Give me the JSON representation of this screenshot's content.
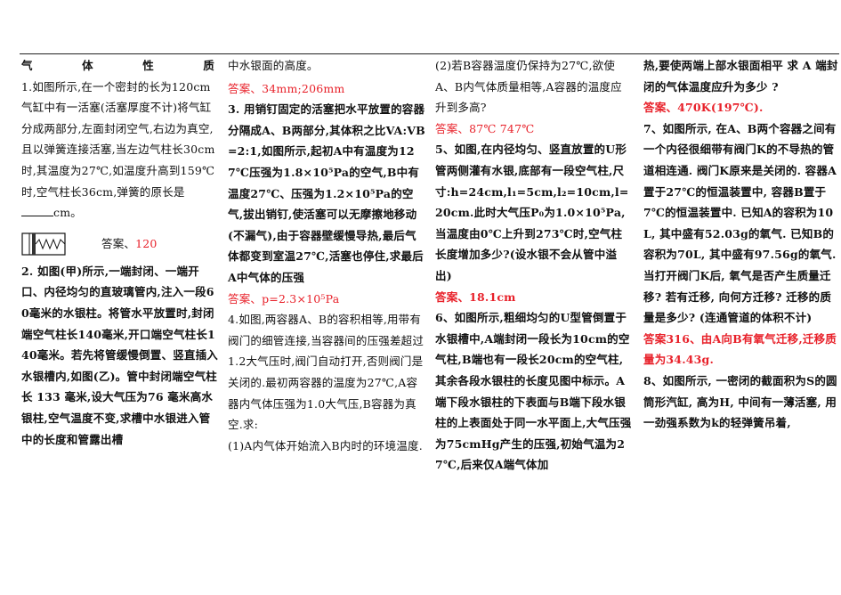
{
  "c1": {
    "title_chars": [
      "气",
      "体",
      "性",
      "质"
    ],
    "q1_text": "1.如图所示,在一个密封的长为120cm气缸中有一活塞(活塞厚度不计)将气缸分成两部分,左面封闭空气,右边为真空,且以弹簧连接活塞,当左边气柱长30cm时,其温度为27℃,如温度升高到159℃时,空气柱长36cm,弹簧的原长是",
    "q1_unit": "cm。",
    "q1_answer_label": "答案、",
    "q1_answer_value": "120",
    "q2_text": "2. 如图(甲)所示,一端封闭、一端开口、内径均匀的直玻璃管内,注入一段60毫米的水银柱。将管水平放置时,封闭端空气柱长140毫米,开口端空气柱长140毫米。若先将管缓慢倒置、竖直插入水银槽内,如图(乙)。管中封闭端空气柱长 133 毫米,设大气压为76 毫米高水银柱,空气温度不变,求槽中水银进入管中的长度和管露出槽"
  },
  "c2": {
    "q2_cont": "中水银面的高度。",
    "q2_answer": "答案、34mm;206mm",
    "q3_text": "3. 用销钉固定的活塞把水平放置的容器分隔成A、B两部分,其体积之比VA:VB=2:1,如图所示,起初A中有温度为127℃压强为1.8×10⁵Pa的空气,B中有温度27℃、压强为1.2×10⁵Pa的空气,拔出销钉,使活塞可以无摩擦地移动(不漏气),由于容器壁缓慢导热,最后气体都变到室温27℃,活塞也停住,求最后A中气体的压强",
    "q3_answer": "答案、p=2.3×10⁵Pa",
    "q4_text": "4.如图,两容器A、B的容积相等,用带有阀门的细管连接,当容器间的压强差超过1.2大气压时,阀门自动打开,否则阀门是关闭的.最初两容器的温度为27℃,A容器内气体压强为1.0大气压,B容器为真空.求:",
    "q4_sub1": "(1)A内气体开始流入B内时的环境温度."
  },
  "c3": {
    "q4_sub2": "(2)若B容器温度仍保持为27℃,欲使A、B内气体质量相等,A容器的温度应升到多高?",
    "q4_answer": "答案、87℃ 747℃",
    "q5_text": "5、如图,在内径均匀、竖直放置的U形管两侧灌有水银,底部有一段空气柱,尺寸:h=24cm,l₁=5cm,l₂=10cm,l=20cm.此时大气压P₀为1.0×10⁵Pa,当温度由0℃上升到273℃时,空气柱长度增加多少?(设水银不会从管中溢出)",
    "q5_answer": "答案、18.1cm",
    "q6_text": "6、如图所示,粗细均匀的U型管倒置于水银槽中,A端封闭一段长为10cm的空气柱,B端也有一段长20cm的空气柱,其余各段水银柱的长度见图中标示。A端下段水银柱的下表面与B端下段水银柱的上表面处于同一水平面上,大气压强为75cmHg产生的压强,初始气温为27℃,后来仅A端气体加"
  },
  "c4": {
    "q6_cont": "热,要使两端上部水银面相平 求 A 端封闭的气体温度应升为多少 ?",
    "q6_answer": "答案、470K(197℃).",
    "q7_text": "7、如图所示, 在A、B两个容器之间有一个内径很细带有阀门K的不导热的管道相连通. 阀门K原来是关闭的. 容器A置于27℃的恒温装置中, 容器B置于7℃的恒温装置中. 已知A的容积为10L, 其中盛有52.03g的氧气. 已知B的容积为70L, 其中盛有97.56g的氧气. 当打开阀门K后, 氧气是否产生质量迁移? 若有迁移, 向何方迁移? 迁移的质量是多少? (连通管道的体积不计)",
    "q7_answer": "答案316、由A向B有氧气迁移,迁移质量为34.43g.",
    "q8_text": "8、如图所示, 一密闭的截面积为S的圆筒形汽缸, 高为H, 中间有一薄活塞, 用一劲强系数为k的轻弹簧吊着,"
  }
}
